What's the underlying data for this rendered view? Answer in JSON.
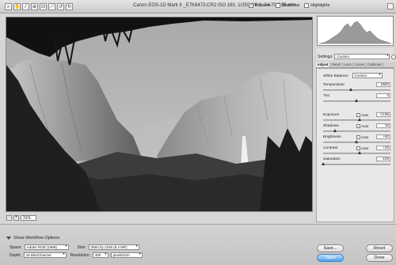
{
  "window": {
    "title": "Canon EOS-1D Mark II  _E7K8473.CR2  ISO 160, 1/250, f/6.3, 24-70@35 mm",
    "preview_label": "Preview",
    "shadows_label": "Shadows",
    "highlights_label": "Highlights",
    "preview_checked": "✓"
  },
  "toolbar": {
    "tools": [
      "zoom-tool",
      "hand-tool",
      "white-balance-tool",
      "color-sampler-tool",
      "crop-tool",
      "straighten-tool",
      "rotate-left-tool",
      "rotate-right-tool"
    ],
    "glyphs": [
      "⌕",
      "✋",
      "⁄",
      "⊕",
      "⊡",
      "⟋",
      "↺",
      "↻"
    ]
  },
  "zoom": {
    "minus": "-",
    "plus": "+",
    "level": "31%"
  },
  "workflow": {
    "toggle_label": "Show Workflow Options",
    "space_label": "Space:",
    "space_value": "Adobe RGB (1998)",
    "size_label": "Size:",
    "size_value": "3504 by 2336  (8.2 MP)",
    "depth_label": "Depth:",
    "depth_value": "16 Bits/Channel",
    "resolution_label": "Resolution:",
    "resolution_value": "300",
    "resolution_unit": "pixels/inch"
  },
  "buttons": {
    "save": "Save...",
    "open": "Open",
    "reset": "Reset",
    "done": "Done"
  },
  "settings": {
    "label": "Settings:",
    "value": "Custom"
  },
  "tabs": [
    "Adjust",
    "Detail",
    "Lens",
    "Curve",
    "Calibrate"
  ],
  "adjust": {
    "white_balance_label": "White Balance:",
    "white_balance_value": "Custom",
    "auto_label": "Auto",
    "sliders": [
      {
        "name": "Temperature",
        "value": "5500",
        "position": 0.42,
        "auto": false
      },
      {
        "name": "Tint",
        "value": "0",
        "position": 0.5,
        "auto": false
      },
      {
        "name": "Exposure",
        "value": "+0.85",
        "position": 0.55,
        "auto": true
      },
      {
        "name": "Shadows",
        "value": "18",
        "position": 0.18,
        "auto": true
      },
      {
        "name": "Brightness",
        "value": "+50",
        "position": 0.5,
        "auto": true
      },
      {
        "name": "Contrast",
        "value": "+25",
        "position": 0.55,
        "auto": true
      },
      {
        "name": "Saturation",
        "value": "-100",
        "position": 0.0,
        "auto": false
      }
    ]
  }
}
